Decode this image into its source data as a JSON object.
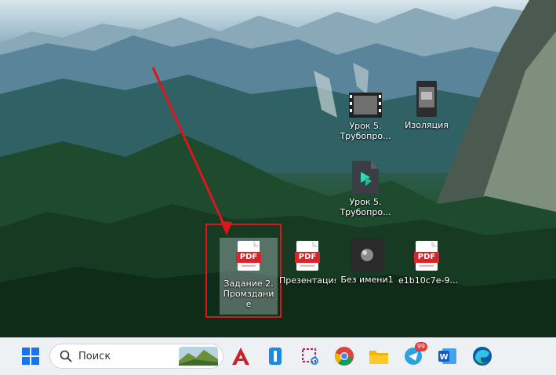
{
  "desktop": {
    "icons": [
      {
        "label": "Урок 5. Трубопро...",
        "icon": "video-file-icon"
      },
      {
        "label": "Изоляция",
        "icon": "image-file-icon"
      },
      {
        "label": "Урок 5. Трубопро...",
        "icon": "filmora-file-icon"
      },
      {
        "label": "Задание 2.Промздание",
        "icon": "pdf-file-icon",
        "badge": "PDF",
        "selected": true
      },
      {
        "label": "Презентация Microsoft P...",
        "icon": "pdf-file-icon",
        "badge": "PDF"
      },
      {
        "label": "Без имени1",
        "icon": "3d-model-file-icon"
      },
      {
        "label": "e1b10c7e-9...",
        "icon": "pdf-file-icon",
        "badge": "PDF"
      }
    ],
    "annotation": {
      "color": "#e0141c"
    }
  },
  "taskbar": {
    "search_placeholder": "Поиск",
    "apps": [
      {
        "name": "start-button",
        "icon": "windows-logo-icon"
      },
      {
        "name": "autocad",
        "icon": "autocad-icon"
      },
      {
        "name": "app-blue",
        "icon": "blue-app-icon"
      },
      {
        "name": "snipping-tool",
        "icon": "snipping-tool-icon"
      },
      {
        "name": "chrome",
        "icon": "chrome-icon"
      },
      {
        "name": "file-explorer",
        "icon": "folder-icon"
      },
      {
        "name": "telegram",
        "icon": "telegram-icon",
        "badge": "99"
      },
      {
        "name": "word",
        "icon": "word-icon"
      },
      {
        "name": "edge",
        "icon": "edge-icon"
      }
    ]
  }
}
